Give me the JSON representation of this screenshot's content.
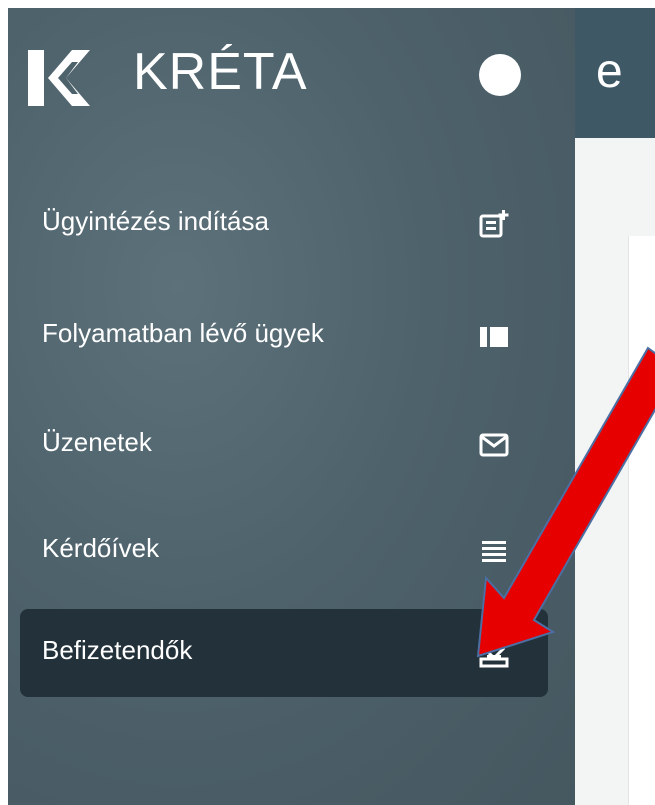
{
  "brand": {
    "name": "KRÉTA",
    "logo_icon": "kreta-logo-icon",
    "theme_toggle_icon": "theme-toggle-dot"
  },
  "header": {
    "title_fragment": "e"
  },
  "sidebar": {
    "items": [
      {
        "label": "Ügyintézés indítása",
        "icon": "new-request-icon",
        "active": false
      },
      {
        "label": "Folyamatban lévő ügyek",
        "icon": "in-progress-icon",
        "active": false
      },
      {
        "label": "Üzenetek",
        "icon": "envelope-icon",
        "active": false
      },
      {
        "label": "Kérdőívek",
        "icon": "list-icon",
        "active": false
      },
      {
        "label": "Befizetendők",
        "icon": "payment-icon",
        "active": true
      }
    ]
  },
  "annotation": {
    "arrow_color": "#e60000",
    "arrow_icon": "red-pointer-arrow"
  },
  "colors": {
    "sidebar": "#4e626c",
    "active_item": "#22313a",
    "header": "#3f5866"
  }
}
